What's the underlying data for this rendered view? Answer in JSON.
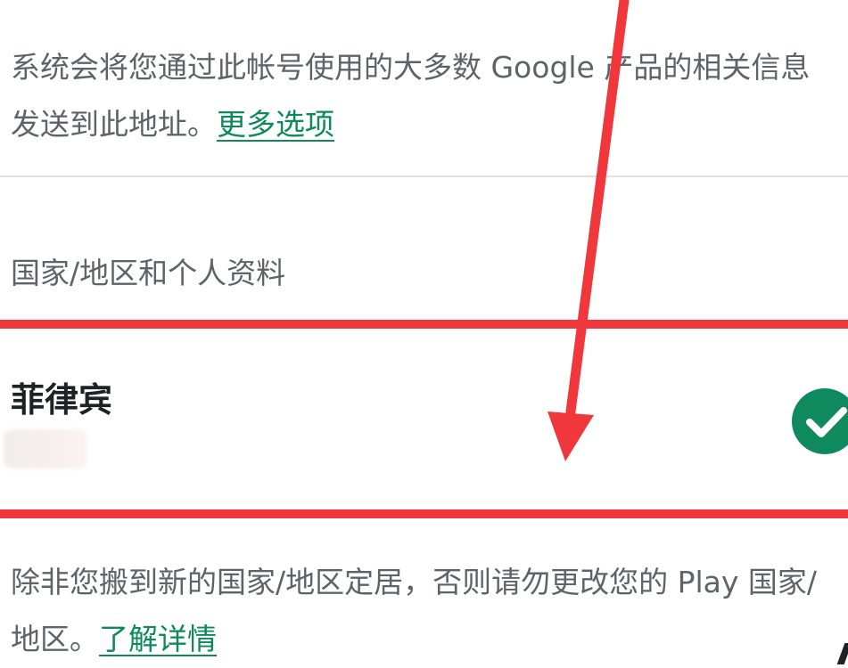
{
  "top_paragraph": {
    "text": "系统会将您通过此帐号使用的大多数 Google 产品的相关信息发送到此地址。",
    "link_label": "更多选项"
  },
  "section": {
    "heading": "国家/地区和个人资料"
  },
  "country_row": {
    "country_name": "菲律宾",
    "selected_icon": "check-circle-icon",
    "selected": true
  },
  "bottom_paragraph": {
    "text": "除非您搬到新的国家/地区定居，否则请勿更改您的 Play 国家/地区。",
    "link_label": "了解详情"
  },
  "annotation": {
    "highlight_color": "#f0373c",
    "arrow_icon": "red-arrow-icon"
  },
  "colors": {
    "accent_green": "#0d8a5c",
    "body_text": "#5f6368",
    "primary_text": "#202124",
    "divider": "#e0e0e0"
  }
}
